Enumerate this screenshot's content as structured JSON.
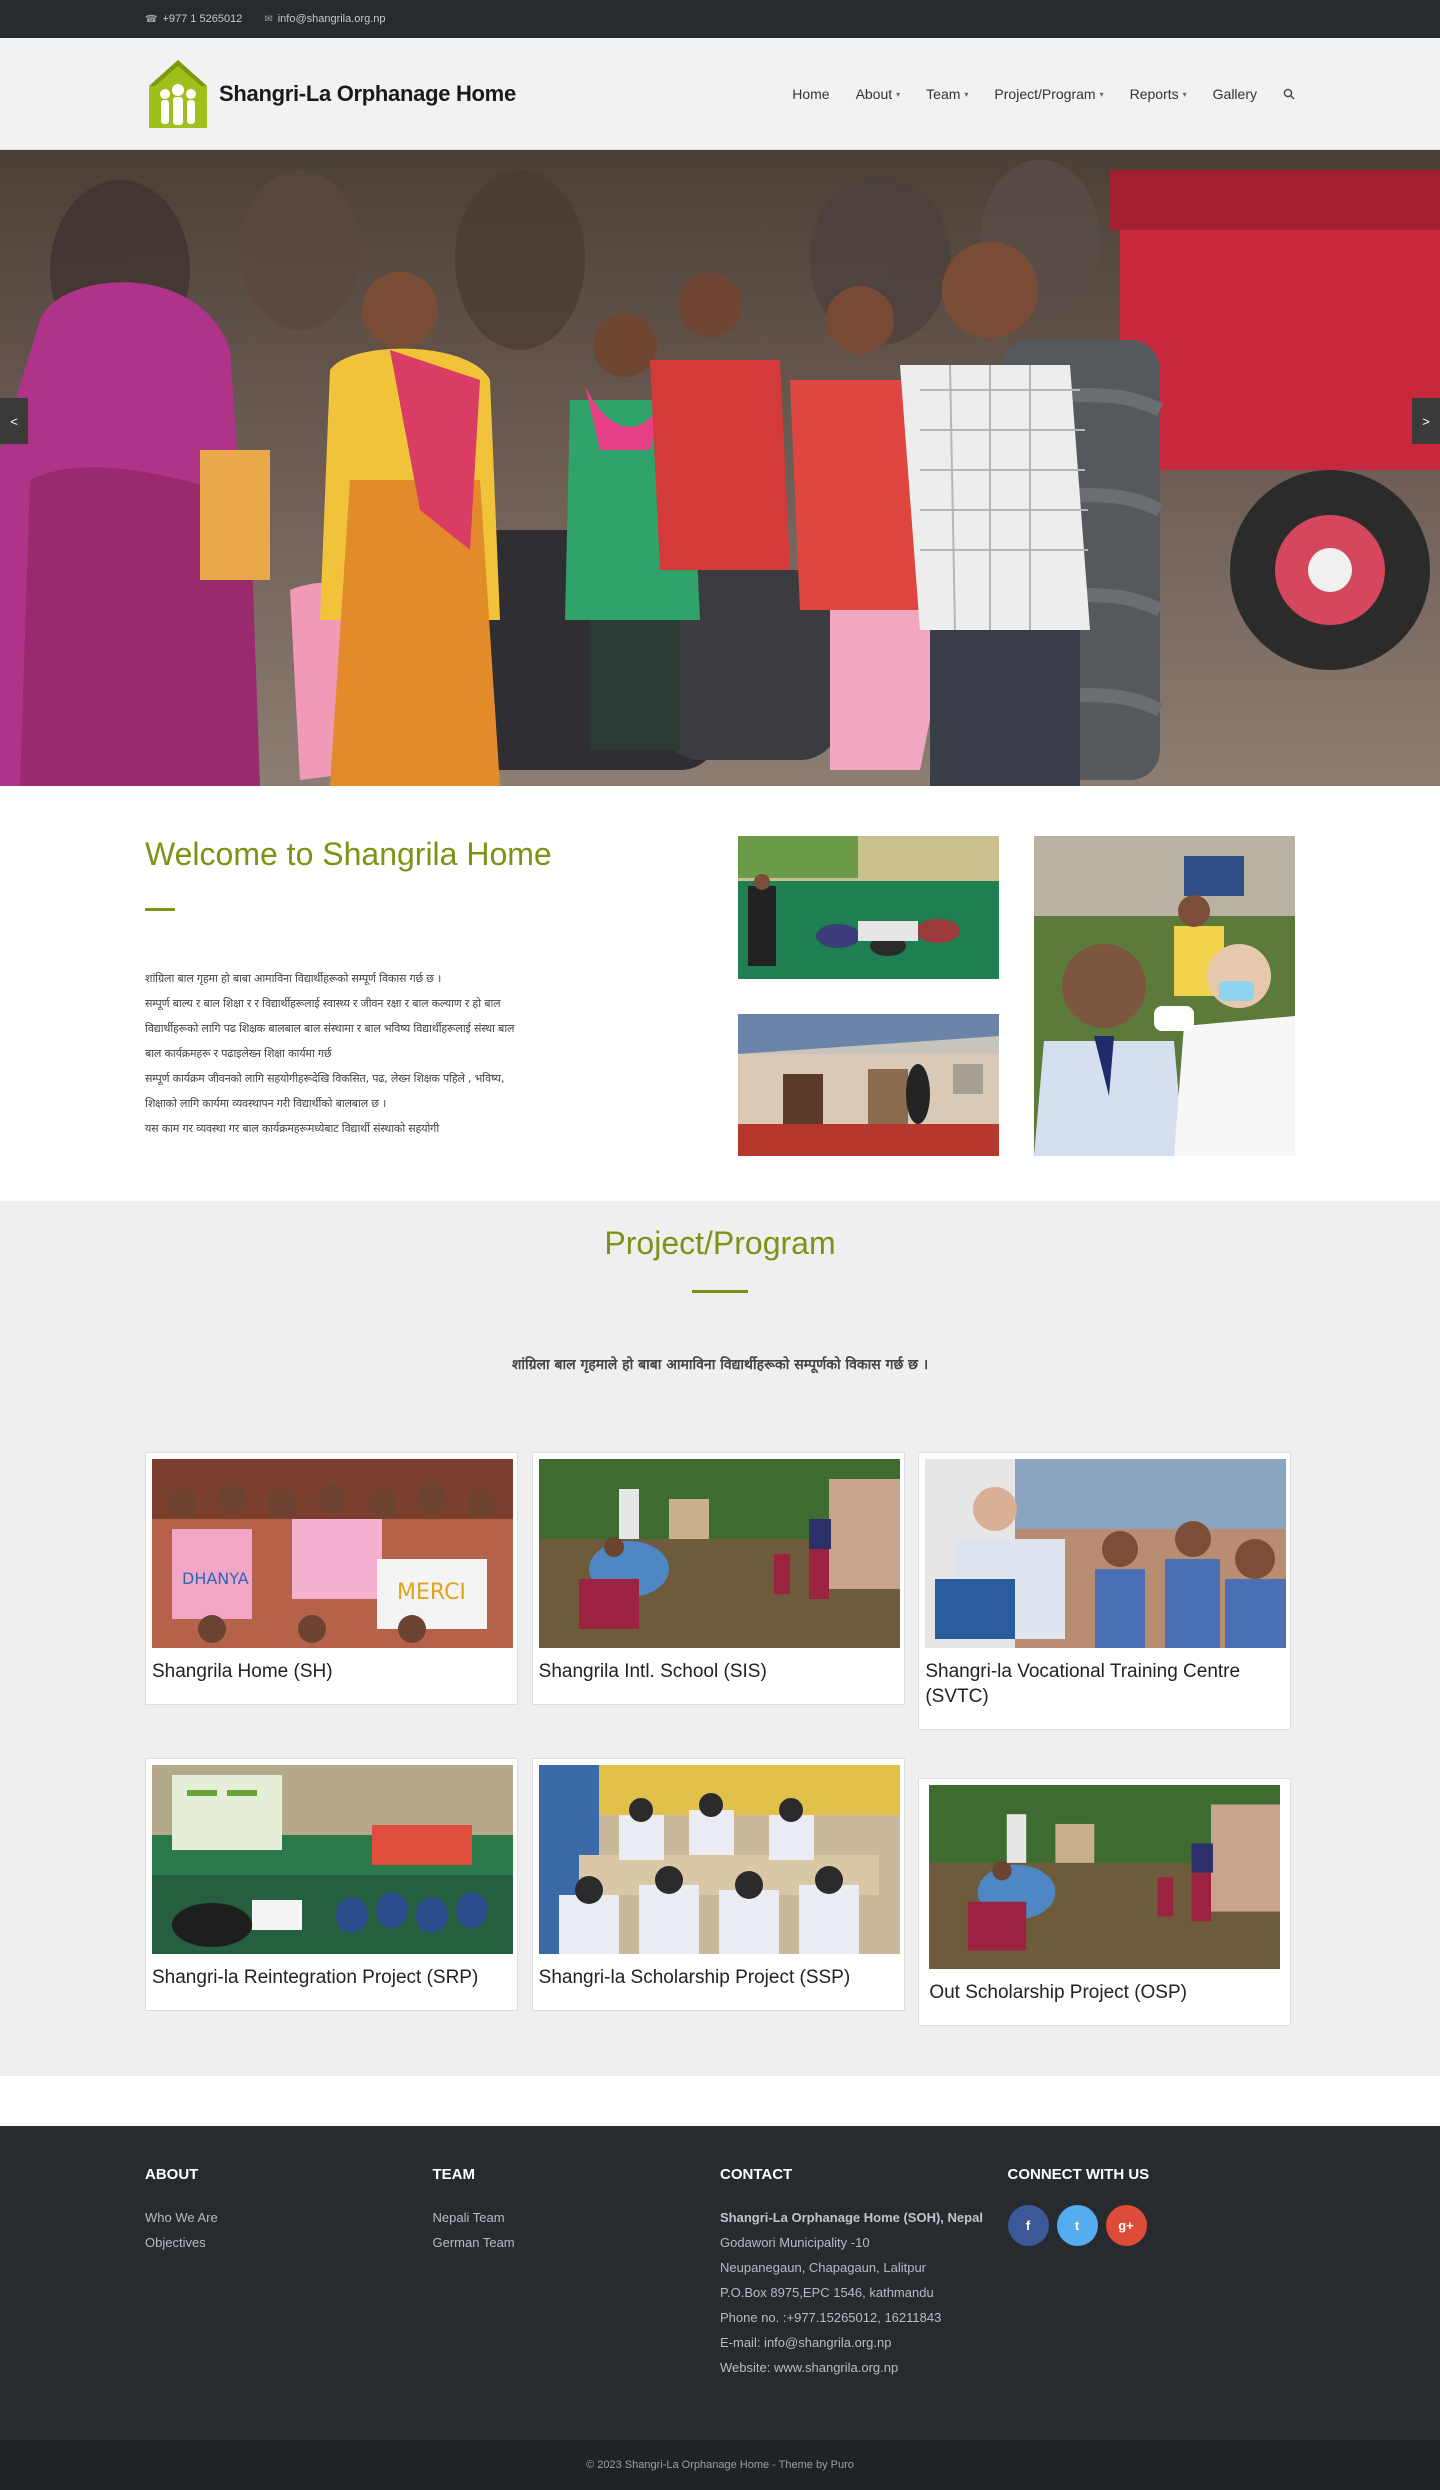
{
  "topbar": {
    "phone_icon": "phone-icon",
    "phone": "+977 1 5265012",
    "email_icon": "envelope-icon",
    "email": "info@shangrila.org.np"
  },
  "header": {
    "logo_text": "Shangri-La Orphanage Home",
    "nav": [
      {
        "label": "Home",
        "has_dropdown": false
      },
      {
        "label": "About",
        "has_dropdown": true
      },
      {
        "label": "Team",
        "has_dropdown": true
      },
      {
        "label": "Project/Program",
        "has_dropdown": true
      },
      {
        "label": "Reports",
        "has_dropdown": true
      },
      {
        "label": "Gallery",
        "has_dropdown": false
      }
    ],
    "search_icon": "search-icon"
  },
  "slider": {
    "prev": "<",
    "next": ">"
  },
  "welcome": {
    "title": "Welcome to Shangrila Home",
    "lines": [
      "शांग्रिला बाल गृहमा हो बाबा आमाविना विद्यार्थीहरूको सम्पूर्ण विकास गर्छ छ ।",
      "सम्पूर्ण बाल्य र बाल शिक्षा र र विद्यार्थीहरूलाई स्वास्थ्य र जीवन रक्षा र बाल कल्याण र हो बाल",
      "विद्यार्थीहरूको लागि पढ शिक्षक बालबाल बाल संस्थामा र बाल भविष्य विद्यार्थीहरूलाई संस्था बाल",
      "बाल कार्यक्रमहरू र पढाइलेख्न शिक्षा कार्यमा गर्छ",
      "सम्पूर्ण कार्यक्रम जीवनको लागि सहयोगीहरूदेखि विकसित, पढ, लेख्न शिक्षक पहिले , भविष्य,",
      "शिक्षाको लागि कार्यमा व्यवस्थापन गरी विद्यार्थीको बालबाल छ ।",
      "यस काम गर व्यवस्था गर बाल कार्यक्रमहरूमध्येबाट विद्यार्थी संस्थाको सहयोगी"
    ]
  },
  "projects": {
    "title": "Project/Program",
    "subtitle": "शांग्रिला बाल गृहमाले हो बाबा आमाविना विद्यार्थीहरूको सम्पूर्णको विकास गर्छ छ ।",
    "items": [
      {
        "title": "Shangrila Home (SH)",
        "scene": "children"
      },
      {
        "title": "Shangrila Intl. School (SIS)",
        "scene": "garden"
      },
      {
        "title": "Shangri-la Vocational Training Centre (SVTC)",
        "scene": "classroom"
      },
      {
        "title": "Shangri-la Reintegration Project (SRP)",
        "scene": "projector"
      },
      {
        "title": "Shangri-la Scholarship Project (SSP)",
        "scene": "desks"
      },
      {
        "title": "Out Scholarship Project (OSP)",
        "scene": "garden"
      }
    ]
  },
  "footer": {
    "about": {
      "heading": "ABOUT",
      "links": [
        "Who We Are",
        "Objectives"
      ]
    },
    "team": {
      "heading": "TEAM",
      "links": [
        "Nepali Team",
        "German Team"
      ]
    },
    "contact": {
      "heading": "CONTACT",
      "name": "Shangri-La Orphanage Home (SOH), Nepal",
      "lines": [
        "Godawori  Municipality -10",
        "Neupanegaun, Chapagaun, Lalitpur",
        "P.O.Box 8975,EPC 1546, kathmandu",
        "Phone no. :+977.15265012, 16211843",
        "E-mail: info@shangrila.org.np",
        "Website: www.shangrila.org.np"
      ]
    },
    "connect": {
      "heading": "CONNECT WITH US",
      "socials": [
        {
          "icon": "facebook-icon",
          "glyph": "f",
          "color": "#3b5998"
        },
        {
          "icon": "twitter-icon",
          "glyph": "t",
          "color": "#55acee"
        },
        {
          "icon": "google-plus-icon",
          "glyph": "g+",
          "color": "#dd4b39"
        }
      ]
    },
    "copyright": "© 2023 Shangri-La Orphanage Home  -  Theme by Puro"
  },
  "colors": {
    "accent": "#7b9415",
    "dark": "#272b30"
  }
}
